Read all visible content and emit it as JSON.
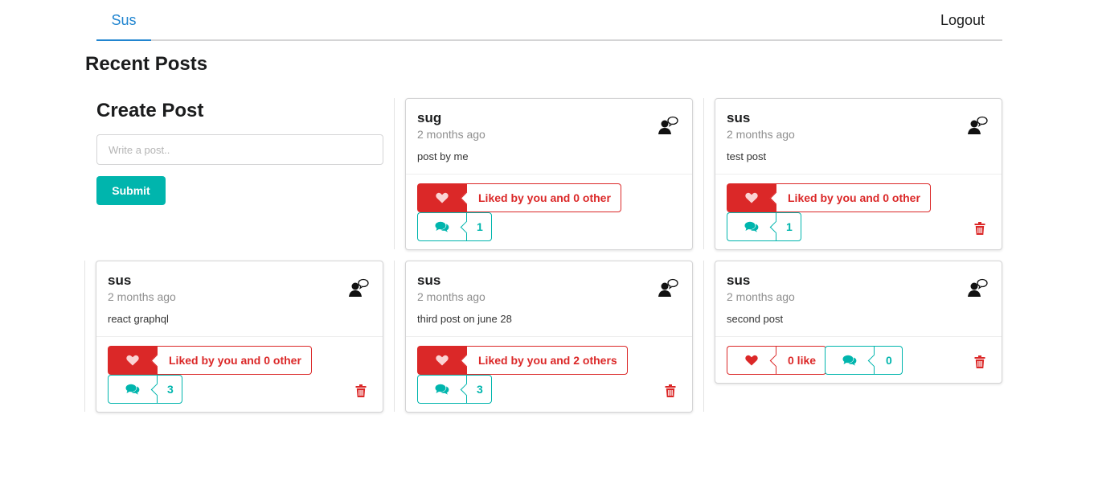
{
  "nav": {
    "home_label": "Sus",
    "logout_label": "Logout"
  },
  "page_title": "Recent Posts",
  "create_post": {
    "title": "Create Post",
    "placeholder": "Write a post..",
    "submit_label": "Submit"
  },
  "colors": {
    "accent_blue": "#2185d0",
    "teal": "#00b5ad",
    "red": "#db2828"
  },
  "posts": [
    {
      "author": "sug",
      "time": "2 months ago",
      "body": "post by me",
      "like_text": "Liked by you and 0 other",
      "comment_count": "1"
    },
    {
      "author": "sus",
      "time": "2 months ago",
      "body": "test post",
      "like_text": "Liked by you and 0 other",
      "comment_count": "1"
    },
    {
      "author": "sus",
      "time": "2 months ago",
      "body": "react graphql",
      "like_text": "Liked by you and 0 other",
      "comment_count": "3"
    },
    {
      "author": "sus",
      "time": "2 months ago",
      "body": "third post on june 28",
      "like_text": "Liked by you and 2 others",
      "comment_count": "3"
    },
    {
      "author": "sus",
      "time": "2 months ago",
      "body": "second post",
      "like_text": "0 like",
      "comment_count": "0"
    }
  ],
  "icons": {
    "avatar": "user-comment-icon",
    "like": "heart-icon",
    "comment": "comments-icon",
    "delete": "trash-icon"
  }
}
